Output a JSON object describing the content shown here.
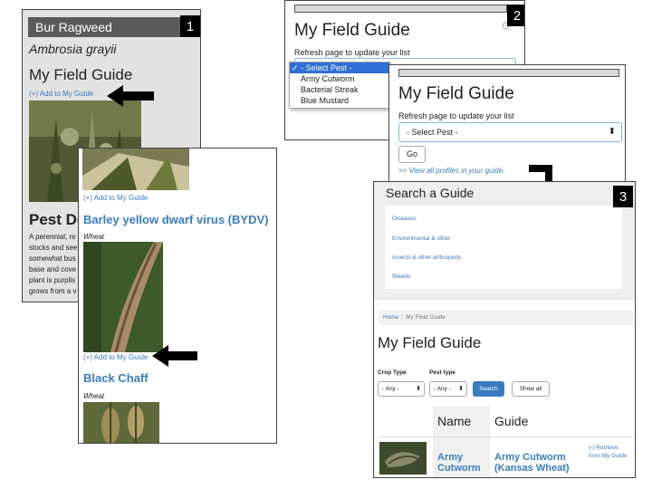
{
  "panel1": {
    "badge": "1",
    "pest_name": "Bur Ragweed",
    "scientific_name": "Ambrosia grayii",
    "guide_title": "My Field Guide",
    "add_link": "(+) Add to My Guide",
    "section_title": "Pest De",
    "description": "A perennial, re stocks and see somewhat bus base and cove plant is purplis grows from a v"
  },
  "panel1b": {
    "add_link_top": "(+) Add to My Guide",
    "entry1_title": "Barley yellow dwarf virus (BYDV)",
    "entry1_crop": "Wheat",
    "add_link_bottom": "(+) Add to My Guide",
    "entry2_title": "Black Chaff",
    "entry2_crop": "Wheat"
  },
  "panel2": {
    "badge": "2",
    "title": "My Field Guide",
    "hint": "Refresh page to update your list",
    "dropdown_options": [
      "✓ - Select Pest -",
      "Army Cutworm",
      "Bacterial Streak",
      "Blue Mustard"
    ]
  },
  "panel2b": {
    "title": "My Field Guide",
    "hint": "Refresh page to update your list",
    "select_value": "- Select Pest -",
    "go_label": "Go",
    "view_all": ">> View all profiles in your guide."
  },
  "panel3": {
    "badge": "3",
    "search_title": "Search a Guide",
    "categories": [
      "Diseases",
      "Environmental & other",
      "Insects & other arthropods",
      "Weeds"
    ],
    "breadcrumb_home": "Home",
    "breadcrumb_sep": "/",
    "breadcrumb_current": "My Field Guide",
    "title": "My Field Guide",
    "crop_type_label": "Crop Type",
    "pest_type_label": "Pest type",
    "crop_type_value": "- Any -",
    "pest_type_value": "- Any -",
    "search_label": "Search",
    "show_all_label": "Show all",
    "col_name": "Name",
    "col_guide": "Guide",
    "row_name": "Army Cutworm",
    "row_guide": "Army Cutworm (Kansas Wheat)",
    "row_remove": "(-) Remove from My Guide"
  },
  "colors": {
    "link": "#3a7bbf",
    "header_bar": "#5a5a5a",
    "dropdown_selected": "#2f6fd6"
  }
}
